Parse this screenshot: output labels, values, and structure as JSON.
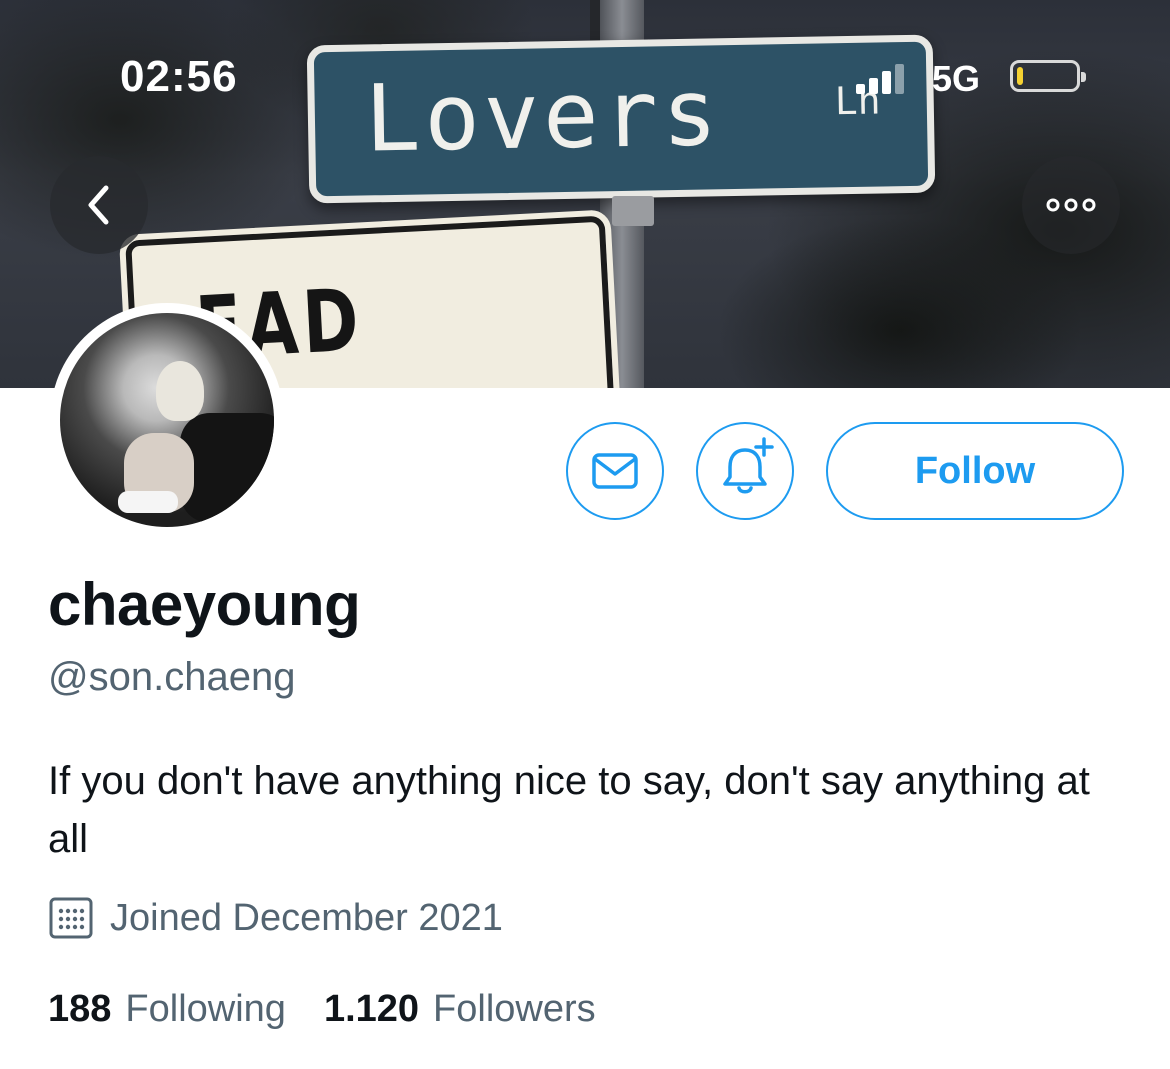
{
  "status_bar": {
    "time": "02:56",
    "network": "5G",
    "battery_level": 0.1,
    "battery_color": "#f5d131"
  },
  "header": {
    "back_icon": "chevron-left-icon",
    "more_icon": "more-horizontal-icon",
    "banner_signs": {
      "street_sign": "Lovers",
      "street_suffix": "Ln",
      "lower_sign": "EAD END"
    }
  },
  "actions": {
    "message_icon": "envelope-icon",
    "notify_icon": "bell-plus-icon",
    "follow_label": "Follow",
    "accent_color": "#1d9bf0"
  },
  "profile": {
    "display_name": "chaeyoung",
    "handle": "@son.chaeng",
    "bio": "If you don't have anything nice to say, don't say anything at all",
    "joined_icon": "calendar-icon",
    "joined": "Joined December 2021"
  },
  "stats": [
    {
      "value": "188",
      "label": "Following"
    },
    {
      "value": "1.120",
      "label": "Followers"
    }
  ]
}
